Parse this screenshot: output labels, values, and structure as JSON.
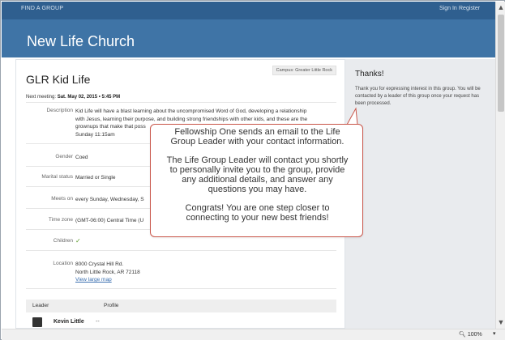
{
  "nav": {
    "find_group": "FIND A GROUP",
    "sign_in": "Sign In",
    "register": "Register"
  },
  "header": {
    "church_name": "New Life Church"
  },
  "group": {
    "campus": "Campus: Greater Little Rock",
    "title": "GLR Kid Life",
    "next_meeting_label": "Next meeting:",
    "next_meeting_value": "Sat. May 02, 2015 • 5:45 PM",
    "details": {
      "description_label": "Description",
      "description_lines": [
        "Kid Life will have a blast learning about the uncompromised Word of God, developing a relationship",
        "with Jesus, learning their purpose, and building strong friendships with other kids, and these are the",
        "grownups that make that poss",
        "Sunday 11:15am"
      ],
      "gender_label": "Gender",
      "gender_value": "Coed",
      "marital_label": "Marital status",
      "marital_value": "Married or Single",
      "meets_label": "Meets on",
      "meets_value": "every Sunday, Wednesday, S",
      "timezone_label": "Time zone",
      "timezone_value": "(GMT-06:00) Central Time (U",
      "children_label": "Children",
      "children_value": "✓",
      "location_label": "Location",
      "location_lines": [
        "8000 Crystal Hill Rd.",
        "North Little Rock, AR 72118"
      ],
      "location_link": "View large map"
    },
    "leaders": {
      "col_leader": "Leader",
      "col_profile": "Profile",
      "rows": [
        {
          "name": "Kevin Little",
          "profile": "--"
        }
      ]
    }
  },
  "thanks": {
    "title": "Thanks!",
    "message": "Thank you for expressing interest in this group. You will be contacted by a leader of this group once your request has been processed."
  },
  "callout": {
    "p1": [
      "Fellowship One sends an email to the Life",
      "Group Leader with your contact information."
    ],
    "p2": [
      "The Life Group Leader will contact you shortly",
      "to personally invite you to the group, provide",
      "any additional details, and answer any",
      "questions you may have."
    ],
    "p3": [
      "Congrats! You are one step closer to",
      "connecting to your new best friends!"
    ]
  },
  "status": {
    "zoom": "100%"
  },
  "colors": {
    "header_bg": "#3f74a6",
    "callout_border": "#c9564a",
    "link": "#3a6fb0"
  }
}
